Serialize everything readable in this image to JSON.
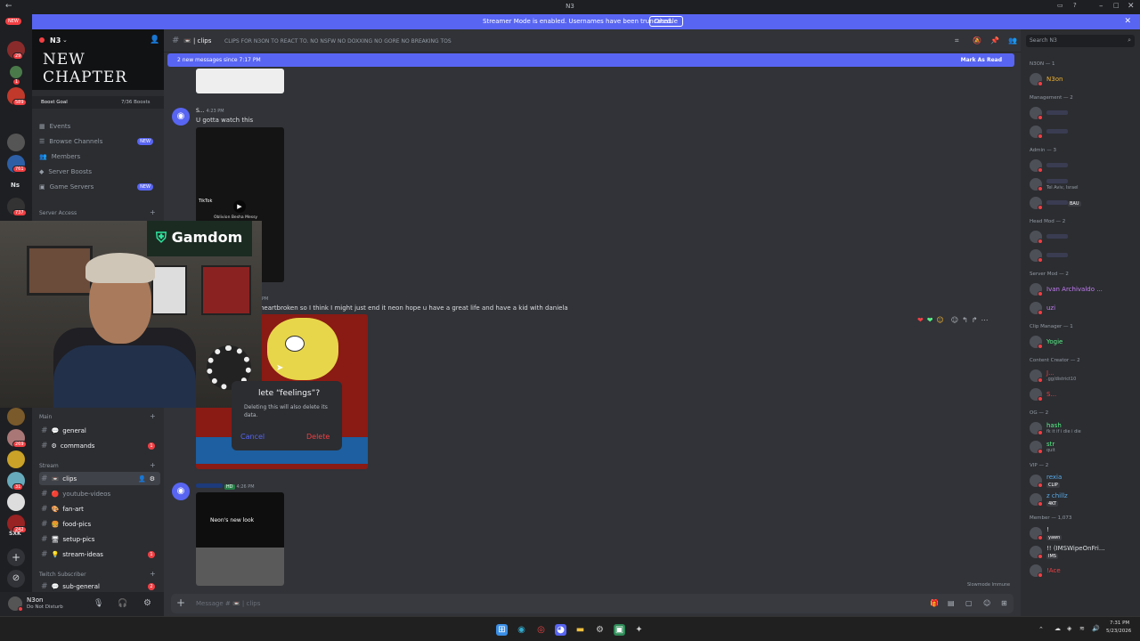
{
  "window": {
    "title": "N3"
  },
  "banner": {
    "message": "Streamer Mode is enabled. Usernames have been truncated.",
    "button": "Disable"
  },
  "guilds": {
    "top_badge": "NEW",
    "badges": [
      "29",
      "1",
      "589",
      "761",
      "737",
      "269",
      "31",
      "242"
    ],
    "labels": [
      "Ns",
      "SXK"
    ]
  },
  "server": {
    "name": "N3",
    "banner_text": "NEW CHAPTER",
    "boost_goal": "Boost Goal",
    "boost_count": "7/36 Boosts"
  },
  "nav_items": [
    {
      "label": "Events",
      "new": ""
    },
    {
      "label": "Browse Channels",
      "new": "NEW"
    },
    {
      "label": "Members",
      "new": ""
    },
    {
      "label": "Server Boosts",
      "new": ""
    },
    {
      "label": "Game Servers",
      "new": "NEW"
    }
  ],
  "categories": {
    "server_access": "Server Access",
    "main": "Main",
    "stream": "Stream",
    "twitch": "Twitch Subscriber"
  },
  "channels": [
    {
      "label": "general",
      "emoji": "💬",
      "badge": ""
    },
    {
      "label": "commands",
      "emoji": "⚙",
      "badge": "1"
    },
    {
      "label": "clips",
      "emoji": "📼",
      "badge": ""
    },
    {
      "label": "youtube-videos",
      "emoji": "🔴",
      "badge": ""
    },
    {
      "label": "fan-art",
      "emoji": "🎨",
      "badge": ""
    },
    {
      "label": "food-pics",
      "emoji": "🍔",
      "badge": ""
    },
    {
      "label": "setup-pics",
      "emoji": "🖥",
      "badge": ""
    },
    {
      "label": "stream-ideas",
      "emoji": "💡",
      "badge": "1"
    },
    {
      "label": "sub-general",
      "emoji": "💬",
      "badge": "2"
    }
  ],
  "user": {
    "name": "N3on",
    "status": "Do Not Disturb"
  },
  "channel_header": {
    "name": "clips",
    "topic": "CLIPS FOR N3ON TO REACT TO. NO NSFW NO DOXXING NO GORE NO BREAKING TOS",
    "search_placeholder": "Search N3"
  },
  "new_messages": {
    "text": "2 new messages since 7:17 PM",
    "mark": "Mark As Read"
  },
  "messages": [
    {
      "user": "S...",
      "time": "4:23 PM",
      "text": "U gotta watch this",
      "video_overlay": "TikTok",
      "video_caption": "Oblivion Besha Messy"
    },
    {
      "time": "PM",
      "text": "heartbroken so I think I might just end it neon hope u have a great life and have a kid with daniela"
    },
    {
      "badge": "HD",
      "time": "4:26 PM",
      "video_caption": "Neon's new look"
    }
  ],
  "dialog": {
    "title": "lete “feelings”?",
    "body": "Deleting this will also delete its data.",
    "cancel": "Cancel",
    "confirm": "Delete"
  },
  "webcam": {
    "sign": "Gamdom"
  },
  "composer": {
    "placeholder": "Message # 📼 | clips",
    "slowmode": "Slowmode Immune"
  },
  "members": [
    {
      "category": "N3ON — 1",
      "users": [
        {
          "name": "N3on",
          "color": "#f0b232",
          "tag": "",
          "sub": ""
        }
      ]
    },
    {
      "category": "Management — 2",
      "users": [
        {
          "name": "",
          "color": "#f23f43",
          "tag": "",
          "sub": ""
        },
        {
          "name": "",
          "color": "#f23f43",
          "tag": "",
          "sub": ""
        }
      ]
    },
    {
      "category": "Admin — 3",
      "users": [
        {
          "name": "",
          "color": "#dbdee1",
          "tag": "",
          "sub": ""
        },
        {
          "name": "",
          "color": "#dbdee1",
          "tag": "",
          "sub": "Tel Aviv, Israel"
        },
        {
          "name": "",
          "color": "#dbdee1",
          "tag": "BAU",
          "sub": ""
        }
      ]
    },
    {
      "category": "Head Mod — 2",
      "users": [
        {
          "name": "",
          "color": "#f23f43",
          "tag": "",
          "sub": ""
        },
        {
          "name": "",
          "color": "#f23f43",
          "tag": "",
          "sub": ""
        }
      ]
    },
    {
      "category": "Server Mod — 2",
      "users": [
        {
          "name": "Ivan Archivaldo ...",
          "color": "#c27cf2",
          "tag": "",
          "sub": ""
        },
        {
          "name": "uzi",
          "color": "#c27cf2",
          "tag": "",
          "sub": ""
        }
      ]
    },
    {
      "category": "Clip Manager — 1",
      "users": [
        {
          "name": "Yogie",
          "color": "#57f287",
          "tag": "",
          "sub": ""
        }
      ]
    },
    {
      "category": "Content Creator — 2",
      "users": [
        {
          "name": "J...",
          "color": "#f23f43",
          "tag": "",
          "sub": ".gg/district10"
        },
        {
          "name": "S...",
          "color": "#f23f43",
          "tag": "",
          "sub": ""
        }
      ]
    },
    {
      "category": "OG — 2",
      "users": [
        {
          "name": "hash",
          "color": "#57f287",
          "tag": "",
          "sub": "fk it if i die i die"
        },
        {
          "name": "str",
          "color": "#57f287",
          "tag": "",
          "sub": "quit"
        }
      ]
    },
    {
      "category": "VIP — 2",
      "users": [
        {
          "name": "rexia",
          "color": "#5aa9e6",
          "tag": "CLIP",
          "sub": ""
        },
        {
          "name": "z chillz",
          "color": "#5aa9e6",
          "tag": "4KT",
          "sub": ""
        }
      ]
    },
    {
      "category": "Member — 1,073",
      "users": [
        {
          "name": "!",
          "color": "#dbdee1",
          "tag": "yawn",
          "sub": ""
        },
        {
          "name": "!! (IMSWipeOnFri...",
          "color": "#dbdee1",
          "tag": "IMS",
          "sub": ""
        },
        {
          "name": "!Ace",
          "color": "#f23f43",
          "tag": "",
          "sub": ""
        }
      ]
    }
  ],
  "taskbar": {
    "time": "7:31 PM",
    "date": "5/23/2026"
  },
  "colors": {
    "blurple": "#5865f2",
    "bg_main": "#313338",
    "bg_sidebar": "#2b2d31",
    "bg_dark": "#1e1f22",
    "dnd": "#f23f43"
  }
}
